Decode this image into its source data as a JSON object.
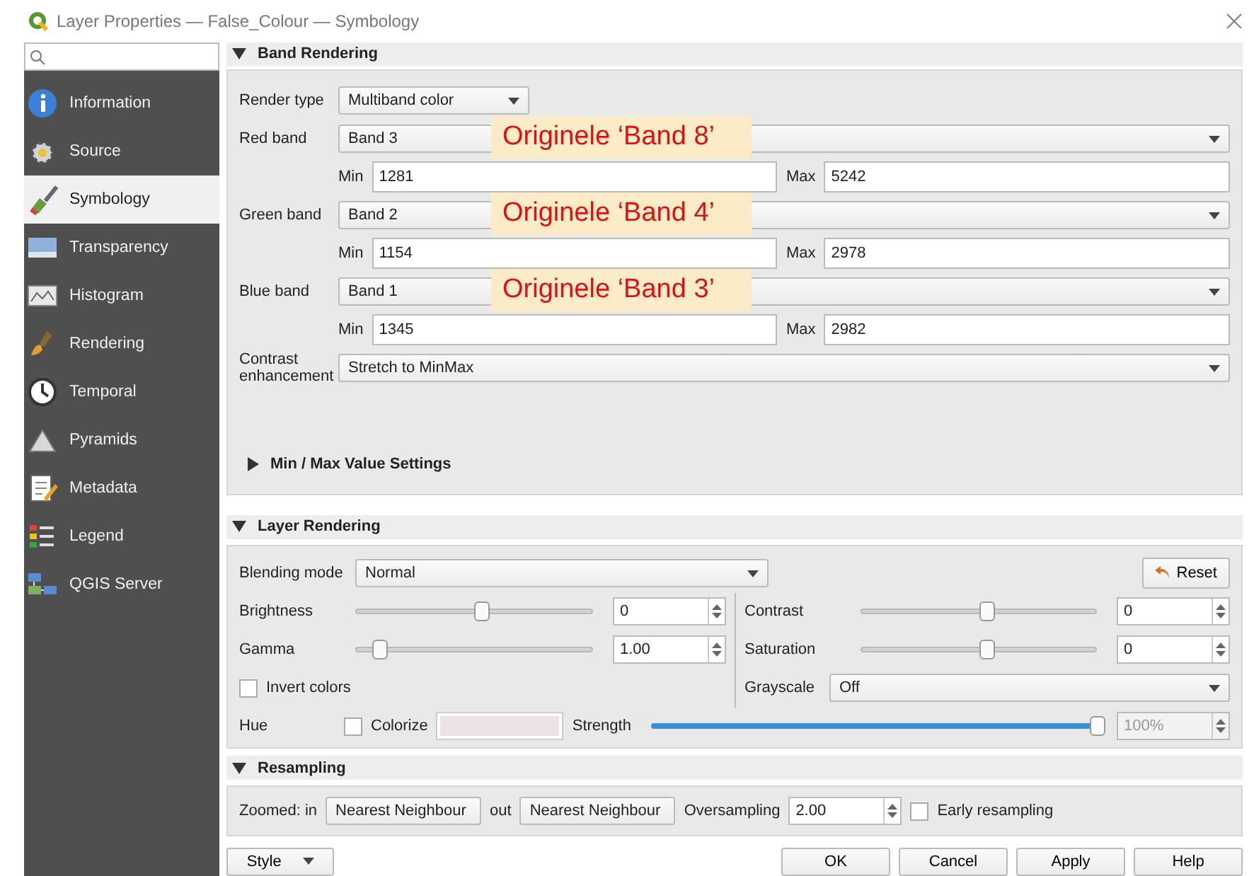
{
  "window": {
    "title": "Layer Properties — False_Colour — Symbology"
  },
  "sidebar": {
    "items": [
      {
        "label": "Information",
        "selected": false
      },
      {
        "label": "Source",
        "selected": false
      },
      {
        "label": "Symbology",
        "selected": true
      },
      {
        "label": "Transparency",
        "selected": false
      },
      {
        "label": "Histogram",
        "selected": false
      },
      {
        "label": "Rendering",
        "selected": false
      },
      {
        "label": "Temporal",
        "selected": false
      },
      {
        "label": "Pyramids",
        "selected": false
      },
      {
        "label": "Metadata",
        "selected": false
      },
      {
        "label": "Legend",
        "selected": false
      },
      {
        "label": "QGIS Server",
        "selected": false
      }
    ]
  },
  "band_rendering": {
    "title": "Band Rendering",
    "expanded": true,
    "render_type": {
      "label": "Render type",
      "value": "Multiband color"
    },
    "bands": [
      {
        "label": "Red band",
        "value": "Band 3",
        "min_label": "Min",
        "min": "1281",
        "max_label": "Max",
        "max": "5242",
        "note": "Originele ‘Band 8’"
      },
      {
        "label": "Green band",
        "value": "Band 2",
        "min_label": "Min",
        "min": "1154",
        "max_label": "Max",
        "max": "2978",
        "note": "Originele ‘Band 4’"
      },
      {
        "label": "Blue band",
        "value": "Band 1",
        "min_label": "Min",
        "min": "1345",
        "max_label": "Max",
        "max": "2982",
        "note": "Originele ‘Band 3’"
      }
    ],
    "contrast": {
      "label": "Contrast enhancement",
      "value": "Stretch to MinMax"
    },
    "min_max_settings": {
      "title": "Min / Max Value Settings",
      "expanded": false
    }
  },
  "layer_rendering": {
    "title": "Layer Rendering",
    "expanded": true,
    "blending": {
      "label": "Blending mode",
      "value": "Normal"
    },
    "reset": "Reset",
    "sliders": [
      {
        "label": "Brightness",
        "level": 0.5,
        "value": "0"
      },
      {
        "label": "Contrast",
        "level": 0.5,
        "value": "0"
      },
      {
        "label": "Gamma",
        "level": 0.1,
        "value": "1.00"
      },
      {
        "label": "Saturation",
        "level": 0.5,
        "value": "0"
      }
    ],
    "invert": {
      "label": "Invert colors",
      "checked": false
    },
    "grayscale": {
      "label": "Grayscale",
      "value": "Off"
    },
    "hue": {
      "label": "Hue",
      "colorize": {
        "label": "Colorize",
        "checked": false
      },
      "strength": {
        "label": "Strength",
        "level": 1.0,
        "value": "100%",
        "disabled": true
      }
    }
  },
  "resampling": {
    "title": "Resampling",
    "expanded": true,
    "in_label": "Zoomed: in",
    "in_value": "Nearest Neighbour",
    "out_label": "out",
    "out_value": "Nearest Neighbour",
    "oversampling_label": "Oversampling",
    "oversampling_value": "2.00",
    "early": {
      "label": "Early resampling",
      "checked": false
    }
  },
  "footer": {
    "style": "Style",
    "buttons": [
      "OK",
      "Cancel",
      "Apply",
      "Help"
    ]
  }
}
